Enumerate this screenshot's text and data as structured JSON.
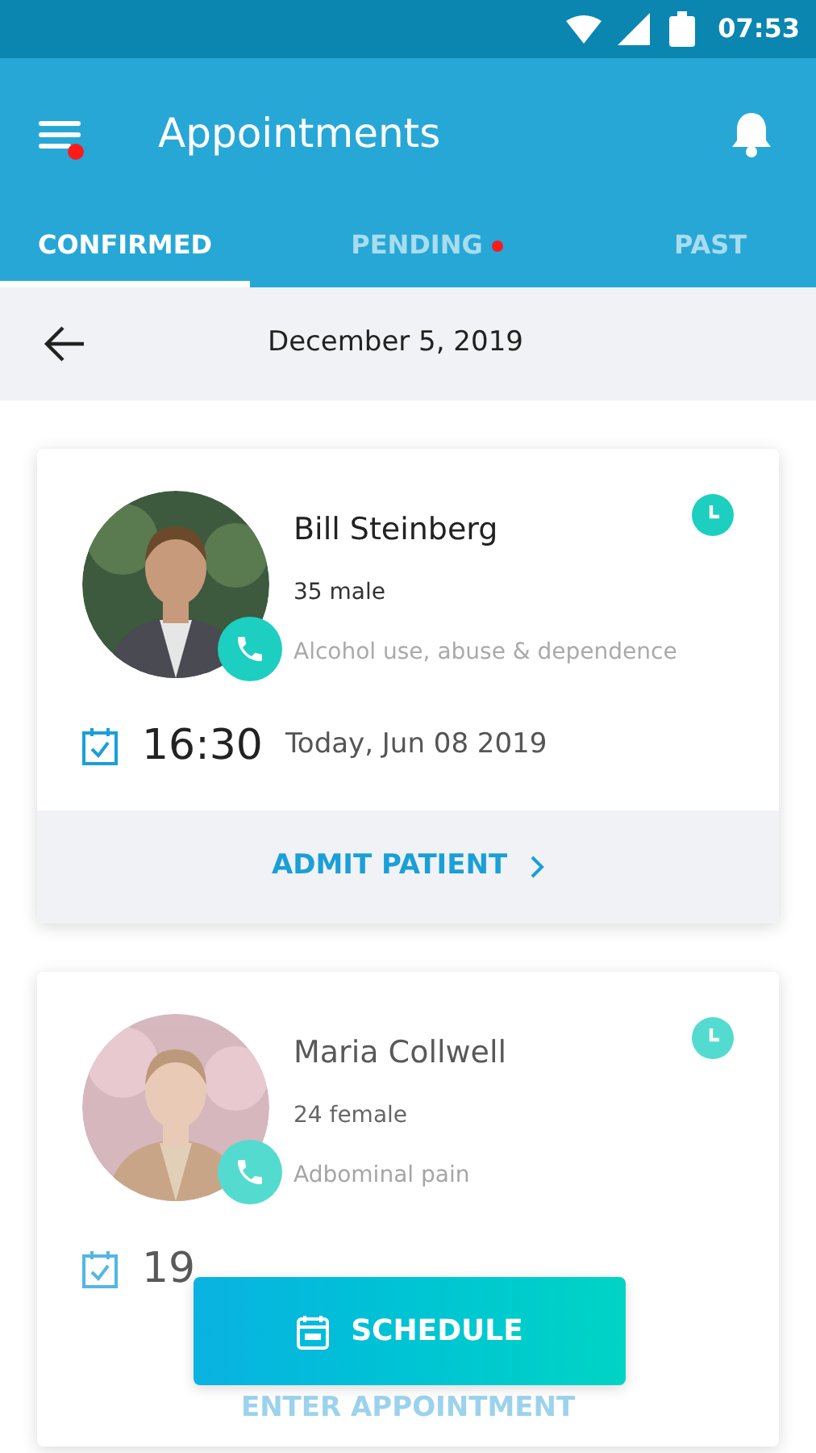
{
  "status_bar": {
    "time": "07:53"
  },
  "app_bar": {
    "title": "Appointments",
    "menu_badge": true
  },
  "tabs": [
    {
      "label": "CONFIRMED",
      "selected": true,
      "badge": false
    },
    {
      "label": "PENDING",
      "selected": false,
      "badge": true
    },
    {
      "label": "PAST",
      "selected": false,
      "badge": false
    }
  ],
  "date_bar": {
    "date": "December 5, 2019"
  },
  "appointments": [
    {
      "name": "Bill Steinberg",
      "age_sex": "35 male",
      "reason": "Alcohol use, abuse & dependence",
      "time": "16:30",
      "date": "Today, Jun 08 2019",
      "action": "ADMIT PATIENT",
      "faded": false
    },
    {
      "name": "Maria Collwell",
      "age_sex": "24 female",
      "reason": "Adbominal pain",
      "time": "19",
      "action": "ENTER APPOINTMENT",
      "faded": true
    }
  ],
  "schedule_button": {
    "label": "SCHEDULE"
  }
}
